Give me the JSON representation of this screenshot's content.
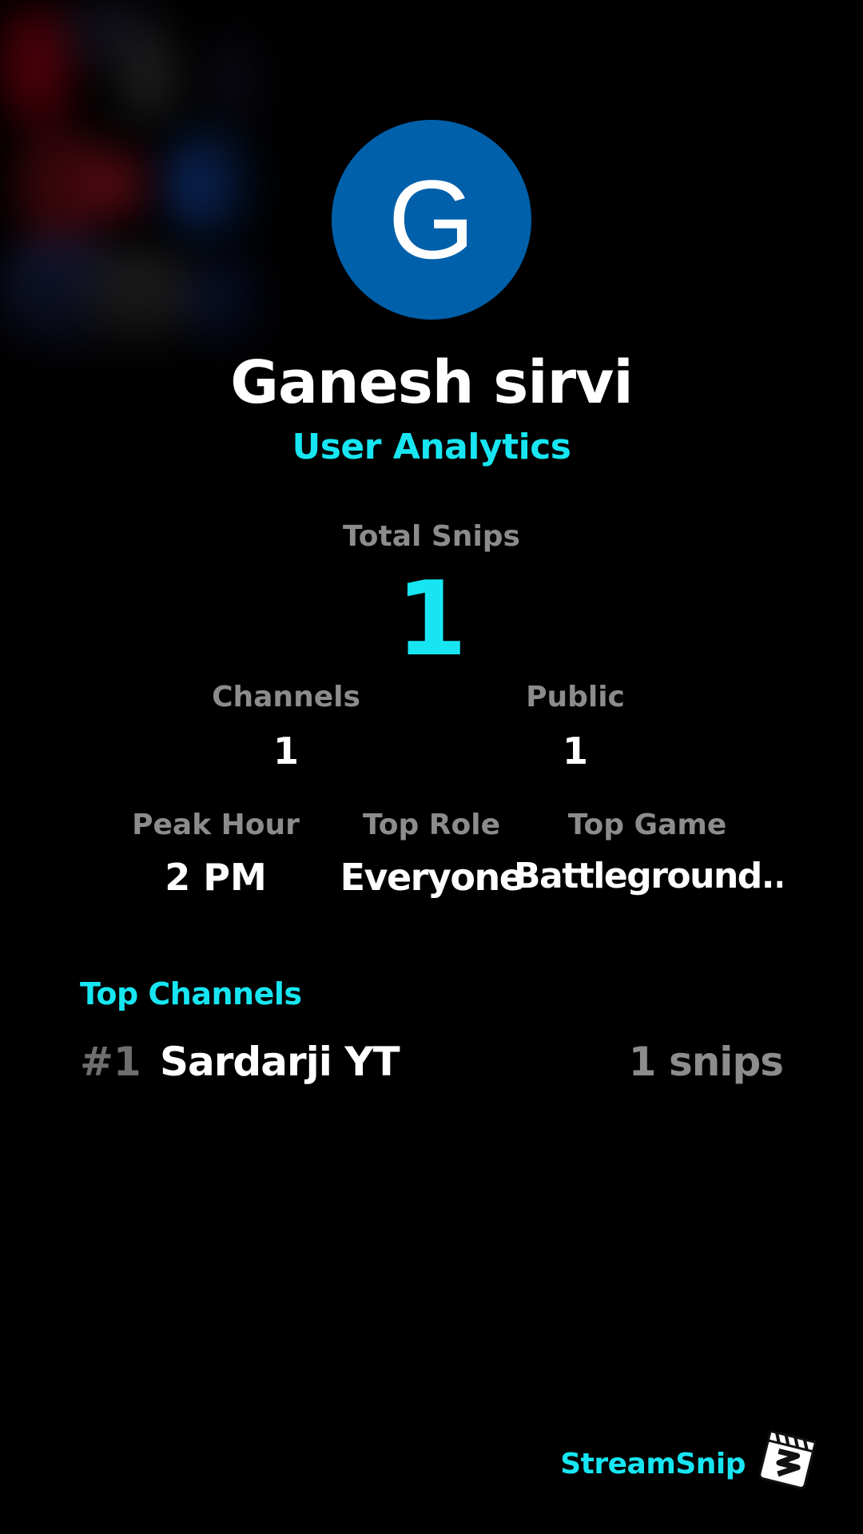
{
  "profile": {
    "avatar_initial": "G",
    "name": "Ganesh sirvi",
    "subtitle": "User Analytics",
    "avatar_color": "#0060aa"
  },
  "totals": {
    "label": "Total Snips",
    "value": "1"
  },
  "stats_row1": {
    "channels_label": "Channels",
    "channels_value": "1",
    "public_label": "Public",
    "public_value": "1"
  },
  "stats_row2": {
    "peak_hour_label": "Peak Hour",
    "peak_hour_value": "2 PM",
    "top_role_label": "Top Role",
    "top_role_value": "Everyone",
    "top_game_label": "Top Game",
    "top_game_value": "Battleground.."
  },
  "top_channels": {
    "title": "Top Channels",
    "items": [
      {
        "rank": "#1",
        "name": "Sardarji YT",
        "count": "1 snips"
      }
    ]
  },
  "brand": {
    "name": "StreamSnip",
    "logo_icon": "clapperboard-icon"
  },
  "colors": {
    "accent": "#17e6f2",
    "background": "#000000",
    "muted": "#8c8c8c"
  }
}
